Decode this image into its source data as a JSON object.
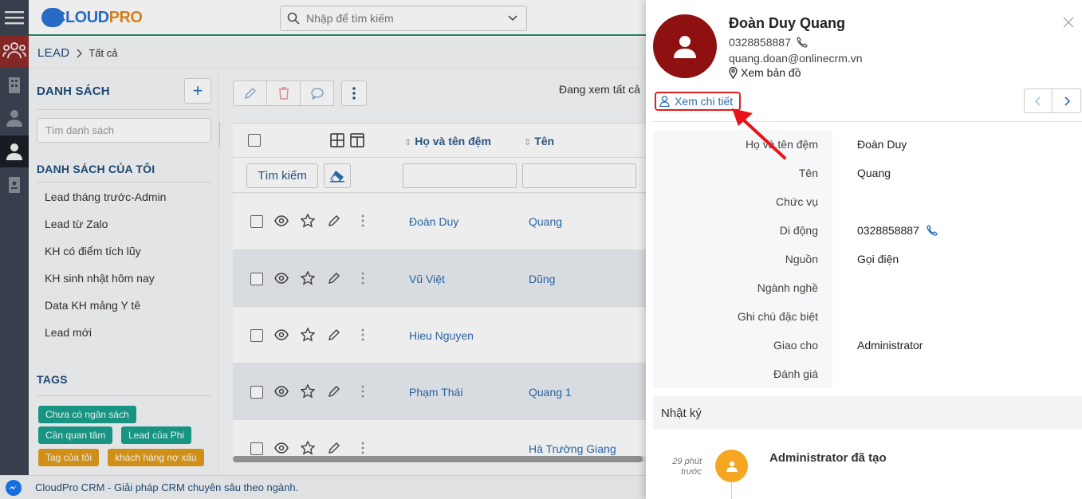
{
  "app": {
    "logo_main": "CLOUD",
    "logo_accent": "PRO"
  },
  "search": {
    "placeholder": "Nhập để tìm kiếm"
  },
  "breadcrumb": {
    "module": "LEAD",
    "current": "Tất cả"
  },
  "sidebar": {
    "lists_title": "DANH SÁCH",
    "add_label": "+",
    "search_placeholder": "Tìm danh sách",
    "my_lists_title": "DANH SÁCH CỦA TÔI",
    "items": [
      "Lead tháng trước-Admin",
      "Lead từ Zalo",
      "KH có điểm tích lũy",
      "KH sinh nhật hôm nay",
      "Data KH mảng Y tê",
      "Lead mới"
    ],
    "tags_title": "TAGS",
    "tags": [
      {
        "label": "Chưa có ngân sách",
        "color": "#1aa08d"
      },
      {
        "label": "Cần quan tâm",
        "color": "#1aa08d"
      },
      {
        "label": "Lead của Phi",
        "color": "#1aa08d"
      },
      {
        "label": "Tag của tôi",
        "color": "#e09b1a"
      },
      {
        "label": "khách hàng nợ xấu",
        "color": "#e09b1a"
      }
    ]
  },
  "main": {
    "viewing_text": "Đang xem tất cả",
    "columns": {
      "middle_name": "Họ và tên đệm",
      "first_name": "Tên"
    },
    "search_button": "Tìm kiếm",
    "rows": [
      {
        "middle": "Đoàn Duy",
        "first": "Quang"
      },
      {
        "middle": "Vũ Việt",
        "first": "Dũng"
      },
      {
        "middle": "Hieu Nguyen",
        "first": ""
      },
      {
        "middle": "Phạm Thái",
        "first": "Quang 1"
      },
      {
        "middle": "",
        "first": "Hà Trường Giang"
      }
    ]
  },
  "footer": {
    "text": "CloudPro CRM - Giải pháp CRM chuyên sâu theo ngành."
  },
  "panel": {
    "name": "Đoàn Duy Quang",
    "phone": "0328858887",
    "email": "quang.doan@onlinecrm.vn",
    "map_label": "Xem bản đồ",
    "detail_label": "Xem chi tiết",
    "fields": [
      {
        "label": "Họ và tên đệm",
        "value": "Đoàn Duy"
      },
      {
        "label": "Tên",
        "value": "Quang"
      },
      {
        "label": "Chức vụ",
        "value": ""
      },
      {
        "label": "Di động",
        "value": "0328858887"
      },
      {
        "label": "Nguồn",
        "value": "Gọi điện"
      },
      {
        "label": "Ngành nghề",
        "value": ""
      },
      {
        "label": "Ghi chú đặc biệt",
        "value": ""
      },
      {
        "label": "Giao cho",
        "value": "Administrator"
      },
      {
        "label": "Đánh giá",
        "value": ""
      }
    ],
    "log_title": "Nhật ký",
    "log_entry": {
      "time_line1": "29 phút",
      "time_line2": "trước",
      "text": "Administrator đã tạo"
    }
  },
  "colors": {
    "brand_blue": "#2b73d6",
    "accent_green": "#2a8a63",
    "avatar_red": "#8f1010",
    "highlight_red": "#e02020",
    "link_blue": "#2c6bb0"
  }
}
